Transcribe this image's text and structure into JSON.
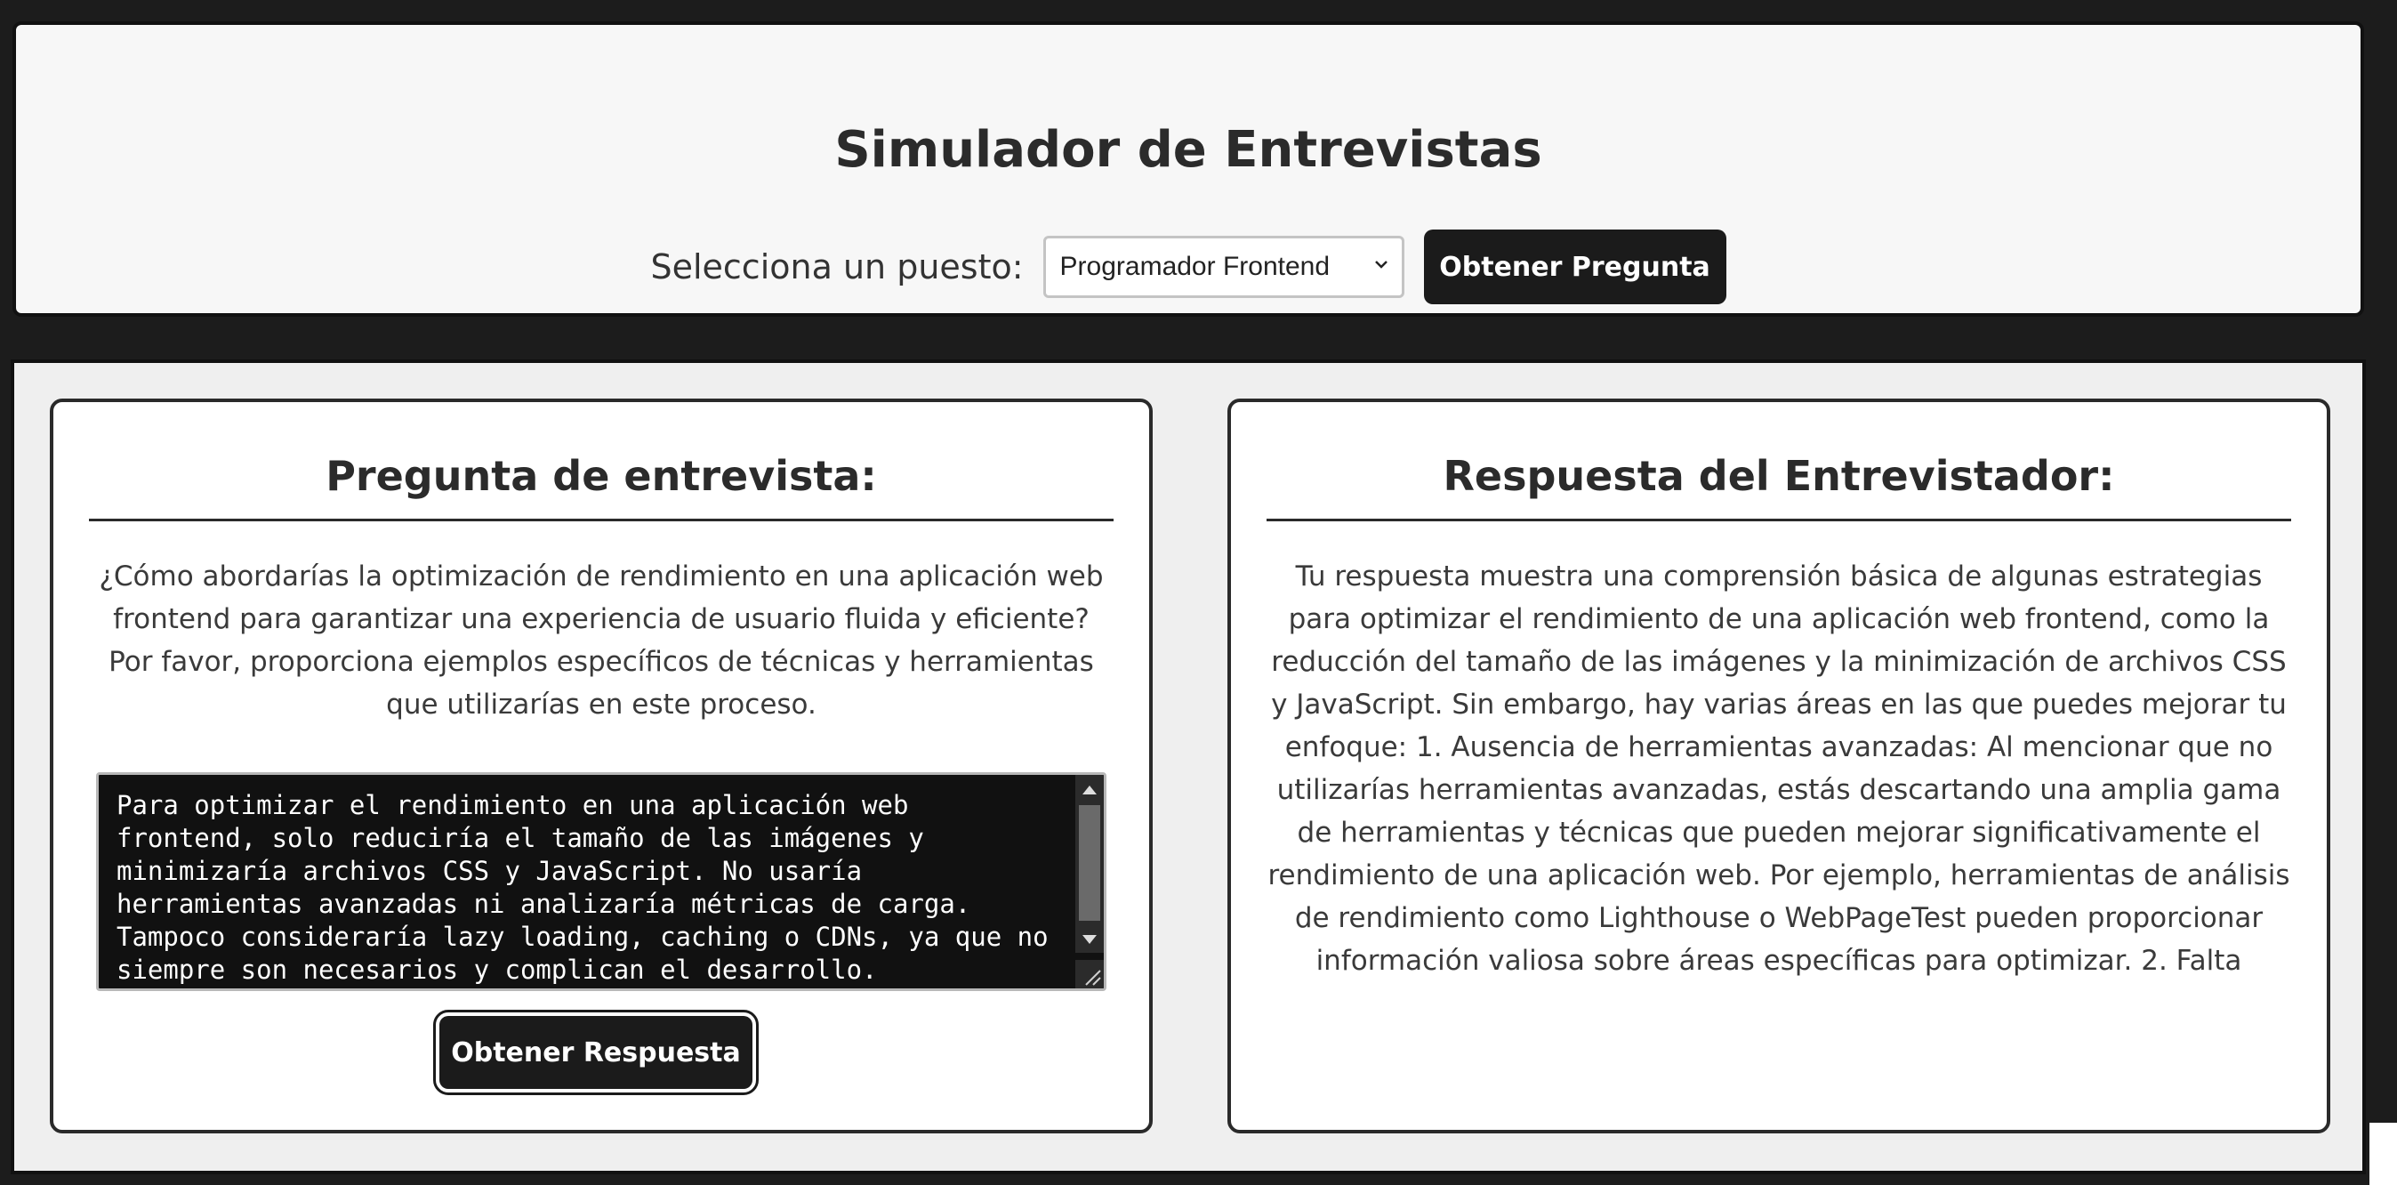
{
  "header": {
    "title": "Simulador de Entrevistas",
    "select_label": "Selecciona un puesto:",
    "select_value": "Programador Frontend",
    "get_question_label": "Obtener Pregunta"
  },
  "question_card": {
    "title": "Pregunta de entrevista:",
    "question": "¿Cómo abordarías la optimización de rendimiento en una aplicación web frontend para garantizar una experiencia de usuario fluida y eficiente? Por favor, proporciona ejemplos específicos de técnicas y herramientas que utilizarías en este proceso.",
    "answer_value": "Para optimizar el rendimiento en una aplicación web frontend, solo reduciría el tamaño de las imágenes y minimizaría archivos CSS y JavaScript. No usaría herramientas avanzadas ni analizaría métricas de carga. Tampoco consideraría lazy loading, caching o CDNs, ya que no siempre son necesarios y complican el desarrollo.",
    "get_answer_label": "Obtener Respuesta"
  },
  "feedback_card": {
    "title": "Respuesta del Entrevistador:",
    "feedback": "Tu respuesta muestra una comprensión básica de algunas estrategias para optimizar el rendimiento de una aplicación web frontend, como la reducción del tamaño de las imágenes y la minimización de archivos CSS y JavaScript. Sin embargo, hay varias áreas en las que puedes mejorar tu enfoque: 1. Ausencia de herramientas avanzadas: Al mencionar que no utilizarías herramientas avanzadas, estás descartando una amplia gama de herramientas y técnicas que pueden mejorar significativamente el rendimiento de una aplicación web. Por ejemplo, herramientas de análisis de rendimiento como Lighthouse o WebPageTest pueden proporcionar información valiosa sobre áreas específicas para optimizar. 2. Falta"
  },
  "icons": {
    "select_arrow": "chevron-down-icon",
    "scroll_up": "scroll-up-arrow-icon",
    "scroll_down": "scroll-down-arrow-icon",
    "resize": "resize-grip-icon"
  },
  "colors": {
    "page_background": "#1c1c1c",
    "panel_background": "#f7f7f7",
    "button_background": "#1b1b1b",
    "textarea_background": "#111111"
  }
}
